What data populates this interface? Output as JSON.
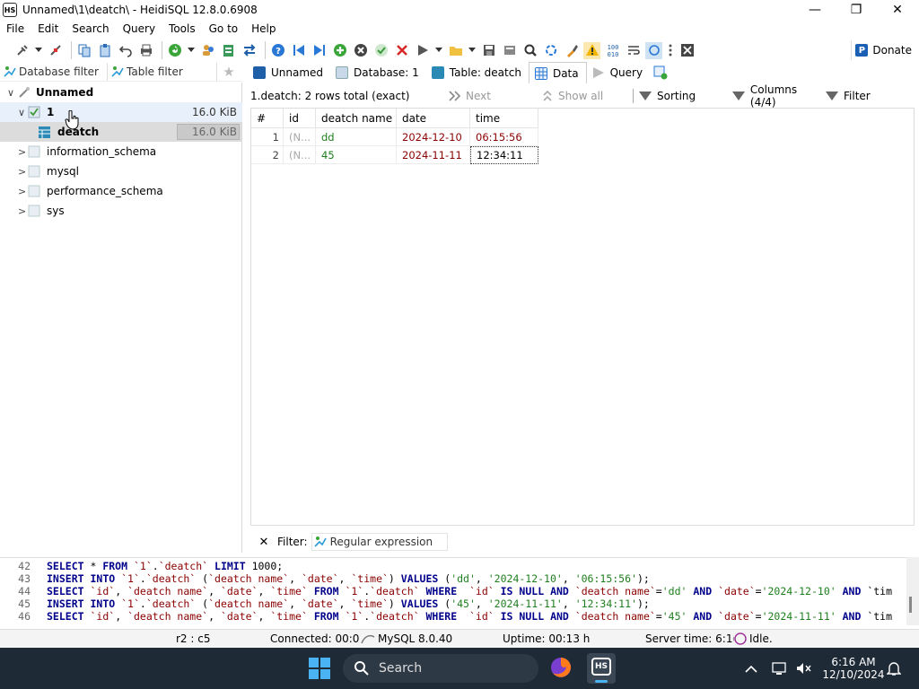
{
  "window": {
    "title": "Unnamed\\1\\deatch\\ - HeidiSQL 12.8.0.6908",
    "logo_text": "HS",
    "minimize_glyph": "—",
    "maximize_glyph": "❐",
    "close_glyph": "✕"
  },
  "menu": [
    "File",
    "Edit",
    "Search",
    "Query",
    "Tools",
    "Go to",
    "Help"
  ],
  "toolbar": {
    "donate_label": "Donate",
    "icons": [
      "connect-icon",
      "disconnect-icon",
      "copy-icon",
      "paste-icon",
      "undo-icon",
      "print-icon",
      "refresh-icon",
      "users-icon",
      "export-icon",
      "transfer-icon",
      "help-icon",
      "first-icon",
      "last-icon",
      "add-row-icon",
      "delete-row-icon",
      "apply-icon",
      "cancel-icon",
      "run-icon",
      "open-folder-icon",
      "save-icon",
      "explain-icon",
      "find-icon",
      "replace-icon",
      "clear-icon",
      "warning-icon",
      "binary-icon",
      "wrap-icon",
      "autorefresh-icon",
      "more-icon",
      "close-tab-icon"
    ]
  },
  "left_filters": {
    "database_filter": "Database filter",
    "table_filter": "Table filter"
  },
  "tabs": [
    {
      "label": "Unnamed",
      "active": false
    },
    {
      "label": "Database: 1",
      "active": false
    },
    {
      "label": "Table: deatch",
      "active": false
    },
    {
      "label": "Data",
      "active": true
    },
    {
      "label": "Query",
      "active": false
    }
  ],
  "tree": {
    "root": "Unnamed",
    "db": {
      "name": "1",
      "size": "16.0 KiB"
    },
    "table": {
      "name": "deatch",
      "size": "16.0 KiB"
    },
    "others": [
      "information_schema",
      "mysql",
      "performance_schema",
      "sys"
    ]
  },
  "grid_header": {
    "summary": "1.deatch: 2 rows total (exact)",
    "next": "Next",
    "show_all": "Show all",
    "sorting": "Sorting",
    "columns": "Columns (4/4)",
    "filter": "Filter"
  },
  "grid": {
    "columns": [
      "#",
      "id",
      "deatch name",
      "date",
      "time"
    ],
    "rows": [
      [
        "1",
        "(N...",
        "dd",
        "2024-12-10",
        "06:15:56"
      ],
      [
        "2",
        "(N...",
        "45",
        "2024-11-11",
        "12:34:11"
      ]
    ]
  },
  "filter_row": {
    "close": "✕",
    "label": "Filter:",
    "placeholder": "Regular expression"
  },
  "sql_log": [
    {
      "n": "42",
      "text": "SELECT * FROM `1`.`deatch` LIMIT 1000;"
    },
    {
      "n": "43",
      "text": "INSERT INTO `1`.`deatch` (`deatch name`, `date`, `time`) VALUES ('dd', '2024-12-10', '06:15:56');"
    },
    {
      "n": "44",
      "text": "SELECT `id`, `deatch name`, `date`, `time` FROM `1`.`deatch` WHERE  `id` IS NULL AND `deatch name`='dd' AND `date`='2024-12-10' AND `tim"
    },
    {
      "n": "45",
      "text": "INSERT INTO `1`.`deatch` (`deatch name`, `date`, `time`) VALUES ('45', '2024-11-11', '12:34:11');"
    },
    {
      "n": "46",
      "text": "SELECT `id`, `deatch name`, `date`, `time` FROM `1`.`deatch` WHERE  `id` IS NULL AND `deatch name`='45' AND `date`='2024-11-11' AND `tim"
    }
  ],
  "status": {
    "cursor": "r2 : c5",
    "connected": "Connected: 00:0",
    "server": "MySQL 8.0.40",
    "uptime": "Uptime: 00:13 h",
    "server_time": "Server time: 6:1(",
    "state": "Idle."
  },
  "taskbar": {
    "search": "Search",
    "time": "6:16 AM",
    "date": "12/10/2024",
    "app_label": "HS"
  },
  "colors": {
    "date_text": "#8b0000",
    "name_text": "#1e7e1e",
    "null_text": "#a8a8a8",
    "selected_tree": "#dcdcdc",
    "hover_tree": "#e8f1fb"
  }
}
